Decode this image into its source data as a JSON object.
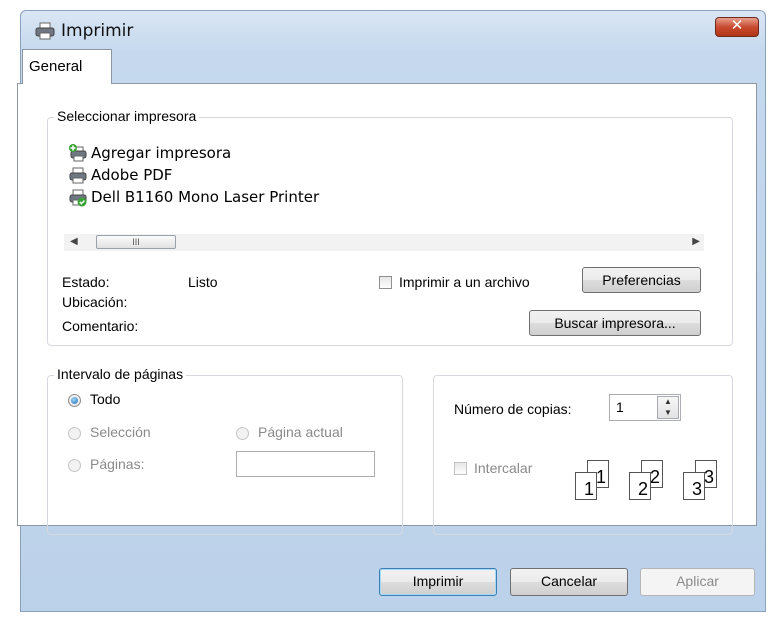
{
  "window": {
    "title": "Imprimir",
    "close_label": "✕"
  },
  "tabs": [
    {
      "label": "General"
    }
  ],
  "select_printer": {
    "group_label": "Seleccionar impresora",
    "printers": [
      {
        "label": "Agregar impresora",
        "icon": "add-printer-icon"
      },
      {
        "label": "Adobe PDF",
        "icon": "printer-icon"
      },
      {
        "label": "Dell B1160 Mono Laser Printer",
        "icon": "default-printer-icon"
      }
    ],
    "scroll_thumb": "III",
    "status_label": "Estado:",
    "status_value": "Listo",
    "location_label": "Ubicación:",
    "comment_label": "Comentario:",
    "print_to_file_label": "Imprimir a un archivo",
    "print_to_file_checked": false,
    "preferences_label": "Preferencias",
    "find_printer_label": "Buscar impresora..."
  },
  "page_range": {
    "group_label": "Intervalo de páginas",
    "all_label": "Todo",
    "selection_label": "Selección",
    "current_page_label": "Página actual",
    "pages_label": "Páginas:",
    "pages_value": "",
    "selected": "all"
  },
  "copies": {
    "copies_label": "Número de copias:",
    "copies_value": "1",
    "collate_label": "Intercalar",
    "collate_checked": false,
    "collate_pages": [
      "1",
      "1",
      "2",
      "2",
      "3",
      "3"
    ]
  },
  "footer": {
    "print_label": "Imprimir",
    "cancel_label": "Cancelar",
    "apply_label": "Aplicar"
  },
  "colors": {
    "accent": "#3c7fb1",
    "close_button": "#c84a2f",
    "title_bar": "#c5d8ee"
  }
}
